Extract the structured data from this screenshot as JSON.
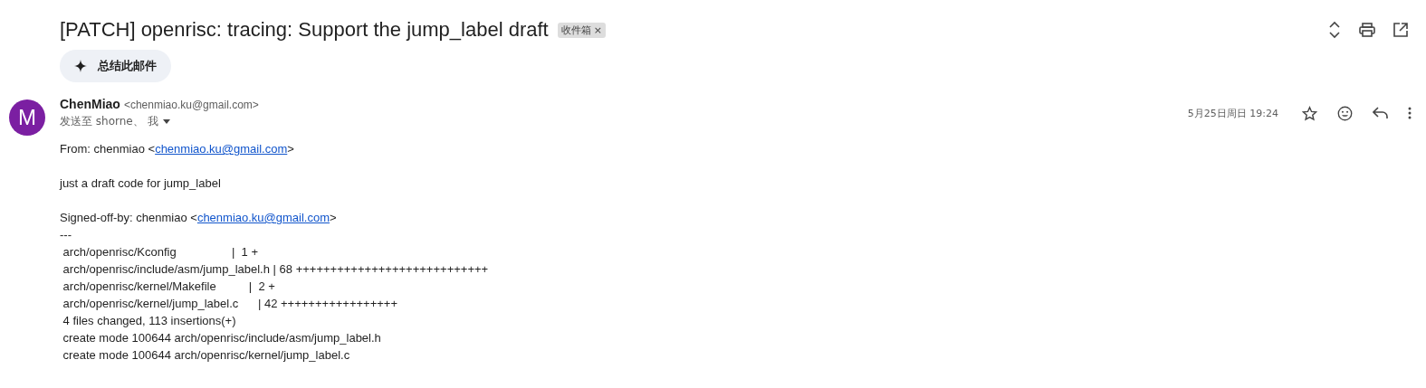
{
  "subject": "[PATCH] openrisc: tracing: Support the jump_label draft",
  "label": {
    "text": "收件箱",
    "remove": "×"
  },
  "summary_button": "总结此邮件",
  "message": {
    "avatar": "M",
    "sender": "ChenMiao",
    "address": "<chenmiao.ku@gmail.com>",
    "recipients": "发送至 shorne、 我",
    "date": "5月25日周日 19:24"
  },
  "body": [
    [
      {
        "prefix": "From: chenmiao <",
        "link": "chenmiao.ku@gmail.com",
        "suffix": ">"
      }
    ],
    [
      {
        "text": "just a draft code for jump_label"
      }
    ],
    [
      {
        "prefix": "Signed-off-by: chenmiao <",
        "link": "chenmiao.ku@gmail.com",
        "suffix": ">"
      },
      {
        "text": "---"
      },
      {
        "text": " arch/openrisc/Kconfig                 |  1 +"
      },
      {
        "text": " arch/openrisc/include/asm/jump_label.h | 68 ++++++++++++++++++++++++++++"
      },
      {
        "text": " arch/openrisc/kernel/Makefile          |  2 +"
      },
      {
        "text": " arch/openrisc/kernel/jump_label.c      | 42 +++++++++++++++++"
      },
      {
        "text": " 4 files changed, 113 insertions(+)"
      },
      {
        "text": " create mode 100644 arch/openrisc/include/asm/jump_label.h"
      },
      {
        "text": " create mode 100644 arch/openrisc/kernel/jump_label.c"
      }
    ]
  ]
}
